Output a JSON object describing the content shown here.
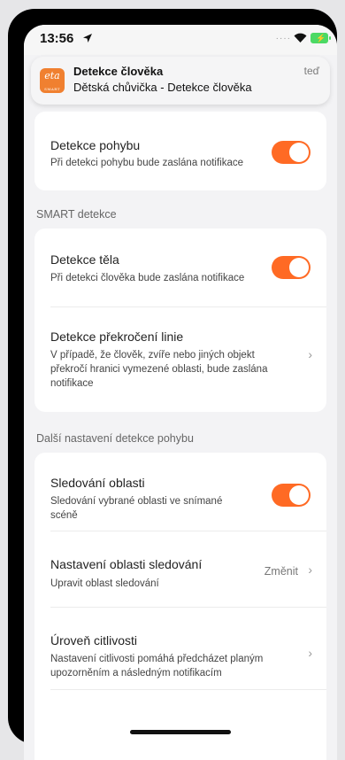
{
  "status_bar": {
    "time": "13:56"
  },
  "notification": {
    "app_icon_text": "eta",
    "app_icon_sub": "SMART",
    "title": "Detekce člověka",
    "body": "Dětská chůvička - Detekce člověka",
    "time": "teď"
  },
  "motion": {
    "title": "Detekce pohybu",
    "subtitle": "Při detekci pohybu bude zaslána notifikace",
    "enabled": true
  },
  "smart": {
    "section_label": "SMART detekce",
    "body_detection": {
      "title": "Detekce těla",
      "subtitle": "Při detekci člověka bude zaslána notifikace",
      "enabled": true
    },
    "line_crossing": {
      "title": "Detekce překročení linie",
      "subtitle": "V případě, že člověk, zvíře nebo jiných objekt překročí hranici vymezené oblasti, bude zaslána notifikace"
    }
  },
  "more": {
    "section_label": "Další nastavení detekce pohybu",
    "area_tracking": {
      "title": "Sledování oblasti",
      "subtitle": "Sledování vybrané oblasti ve snímané scéně",
      "enabled": true
    },
    "area_settings": {
      "title": "Nastavení oblasti sledování",
      "subtitle": "Upravit oblast sledování",
      "action": "Změnit"
    },
    "sensitivity": {
      "title": "Úroveň citlivosti",
      "subtitle": "Nastavení citlivosti pomáhá předcházet planým upozorněním a následným notifikacím"
    }
  },
  "colors": {
    "accent": "#ff6a24",
    "background": "#f3f3f5"
  }
}
